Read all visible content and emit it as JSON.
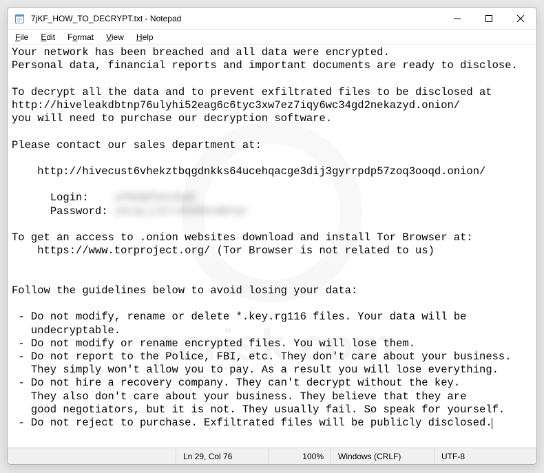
{
  "titlebar": {
    "title": "7jKF_HOW_TO_DECRYPT.txt - Notepad"
  },
  "menu": {
    "file": "File",
    "edit": "Edit",
    "format": "Format",
    "view": "View",
    "help": "Help"
  },
  "note": {
    "line1": "Your network has been breached and all data were encrypted.",
    "line2": "Personal data, financial reports and important documents are ready to disclose.",
    "line3": "To decrypt all the data and to prevent exfiltrated files to be disclosed at",
    "line4": "http://hiveleakdbtnp76ulyhi52eag6c6tyc3xw7ez7iqy6wc34gd2nekazyd.onion/",
    "line5": "you will need to purchase our decryption software.",
    "line6": "Please contact our sales department at:",
    "line7": "    http://hivecust6vhekztbqgdnkks64ucehqacge3dij3gyrrpdp57zoq3ooqd.onion/",
    "line8a": "      Login:    ",
    "line8b_redacted": "xPNdQFbAvEwB",
    "line9a": "      Password: ",
    "line9b_redacted": "jKzqLjJk7vR68En8B7pr",
    "line10": "To get an access to .onion websites download and install Tor Browser at:",
    "line11": "    https://www.torproject.org/ (Tor Browser is not related to us)",
    "line12": "Follow the guidelines below to avoid losing your data:",
    "g1": " - Do not modify, rename or delete *.key.rg116 files. Your data will be\n   undecryptable.",
    "g2": " - Do not modify or rename encrypted files. You will lose them.",
    "g3": " - Do not report to the Police, FBI, etc. They don't care about your business.\n   They simply won't allow you to pay. As a result you will lose everything.",
    "g4": " - Do not hire a recovery company. They can't decrypt without the key.\n   They also don't care about your business. They believe that they are\n   good negotiators, but it is not. They usually fail. So speak for yourself.",
    "g5": " - Do not reject to purchase. Exfiltrated files will be publicly disclosed."
  },
  "status": {
    "position": "Ln 29, Col 76",
    "zoom": "100%",
    "eol": "Windows (CRLF)",
    "encoding": "UTF-8"
  },
  "watermark": {
    "text": "pcrisk.com"
  }
}
